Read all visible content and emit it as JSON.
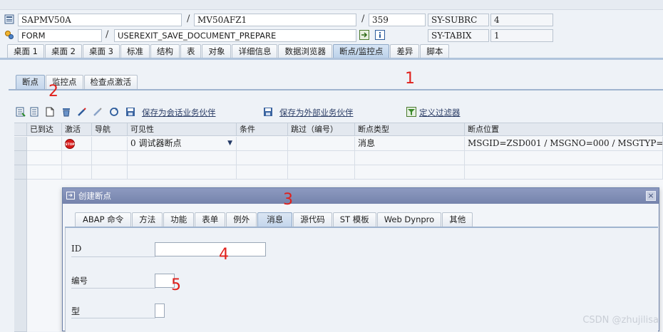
{
  "header": {
    "program": "SAPMV50A",
    "include": "MV50AFZ1",
    "line": "359",
    "sy_subrc_label": "SY-SUBRC",
    "sy_subrc_value": "4",
    "event_type": "FORM",
    "event_name": "USEREXIT_SAVE_DOCUMENT_PREPARE",
    "sy_tabix_label": "SY-TABIX",
    "sy_tabix_value": "1"
  },
  "main_tabs": [
    {
      "label": "桌面 1"
    },
    {
      "label": "桌面 2"
    },
    {
      "label": "桌面 3"
    },
    {
      "label": "标准"
    },
    {
      "label": "结构"
    },
    {
      "label": "表"
    },
    {
      "label": "对象"
    },
    {
      "label": "详细信息"
    },
    {
      "label": "数据浏览器"
    },
    {
      "label": "断点/监控点"
    },
    {
      "label": "差异"
    },
    {
      "label": "脚本"
    }
  ],
  "sub_tabs": [
    {
      "label": "断点"
    },
    {
      "label": "监控点"
    },
    {
      "label": "检查点激活"
    }
  ],
  "toolbar": {
    "save_session": "保存为会话业务伙伴",
    "save_external": "保存为外部业务伙伴",
    "define_filter": "定义过滤器"
  },
  "table": {
    "columns": [
      "已到达",
      "激活",
      "导航",
      "可见性",
      "条件",
      "跳过（编号）",
      "断点类型",
      "断点位置"
    ],
    "rows": [
      {
        "reached": "",
        "visibility": "0 调试器断点",
        "condition": "",
        "skip": "",
        "type": "消息",
        "location": "MSGID=ZSD001 / MSGNO=000 / MSGTYP="
      }
    ]
  },
  "dialog": {
    "title": "创建断点",
    "close": "×",
    "tabs": [
      {
        "label": "ABAP 命令"
      },
      {
        "label": "方法"
      },
      {
        "label": "功能"
      },
      {
        "label": "表单"
      },
      {
        "label": "例外"
      },
      {
        "label": "消息"
      },
      {
        "label": "源代码"
      },
      {
        "label": "ST 模板"
      },
      {
        "label": "Web Dynpro"
      },
      {
        "label": "其他"
      }
    ],
    "fields": {
      "id_label": "ID",
      "id_value": "",
      "number_label": "编号",
      "number_value": "",
      "type_label": "型",
      "type_value": ""
    }
  },
  "annotations": [
    "1",
    "2",
    "3",
    "4",
    "5"
  ],
  "watermark": "CSDN @zhujilisa",
  "colors": {
    "accent": "#c4d6ec",
    "annotation_red": "#e0201b",
    "dialog_title": "#7f8cb5"
  }
}
